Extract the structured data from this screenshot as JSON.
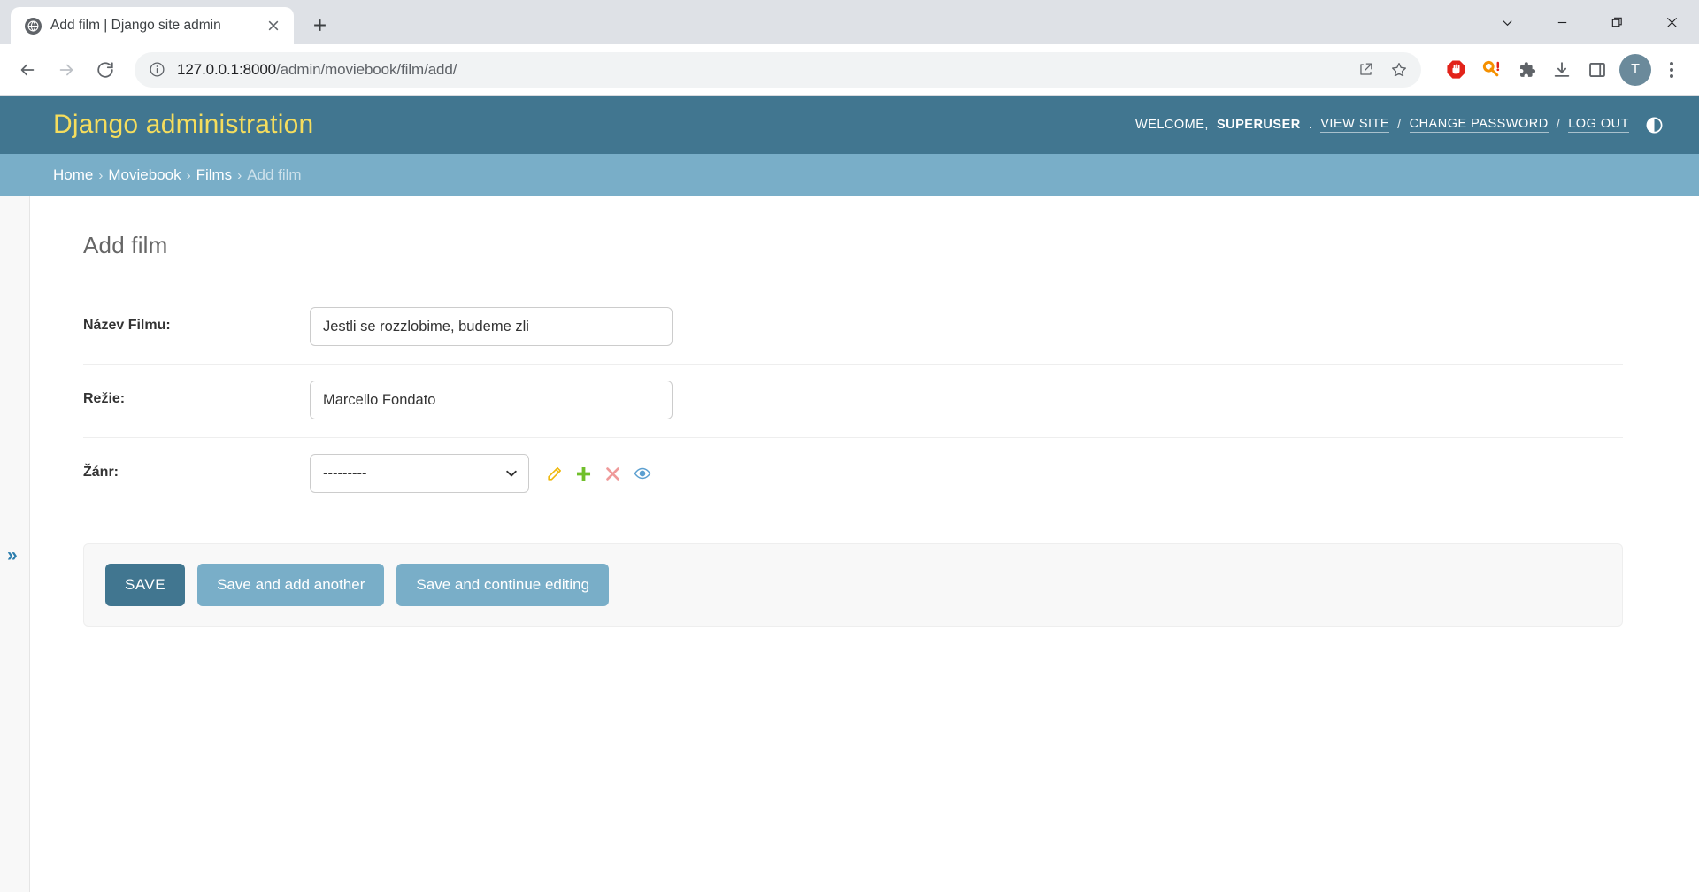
{
  "browser": {
    "tab": {
      "title": "Add film | Django site admin",
      "favicon_name": "globe-icon",
      "close_label": "×"
    },
    "new_tab_label": "+",
    "window_controls": {
      "tab_search": "tab-search-chevron",
      "minimize": "minimize",
      "restore": "restore",
      "close": "close"
    },
    "nav": {
      "back": "back-arrow",
      "forward": "forward-arrow",
      "reload": "reload"
    },
    "omnibox": {
      "url_host": "127.0.0.1:8000",
      "url_path": "/admin/moviebook/film/add/",
      "info_icon": "site-information-icon",
      "share_icon": "share-icon",
      "bookmark_icon": "bookmark-star-icon"
    },
    "extensions": [
      {
        "name": "adblock-icon",
        "color": "#e2231a"
      },
      {
        "name": "password-key-icon",
        "color": "#f59000"
      },
      {
        "name": "extensions-puzzle-icon",
        "color": "#5f6368"
      },
      {
        "name": "downloads-icon",
        "color": "#5f6368"
      },
      {
        "name": "side-panel-icon",
        "color": "#5f6368"
      }
    ],
    "profile": {
      "initial": "T",
      "color": "#6b8a9b"
    },
    "menu_icon": "three-dot-menu-icon"
  },
  "django": {
    "brand": "Django administration",
    "brand_color": "#f5dd5d",
    "header_color": "#417690",
    "breadcrumb_color": "#79aec8",
    "usertools": {
      "welcome_prefix": "Welcome,",
      "username": "SUPERUSER",
      "period": ".",
      "view_site": "View site",
      "sep1": "/",
      "change_password": "Change password",
      "sep2": "/",
      "log_out": "Log out",
      "theme_toggle_icon": "theme-toggle-icon"
    },
    "breadcrumbs": [
      {
        "label": "Home",
        "current": false
      },
      {
        "label": "Moviebook",
        "current": false
      },
      {
        "label": "Films",
        "current": false
      },
      {
        "label": "Add film",
        "current": true
      }
    ],
    "breadcrumb_separator": "›",
    "sidebar_toggle_label": "»",
    "page_title": "Add film",
    "form": {
      "rows": [
        {
          "label": "Název Filmu:",
          "type": "text",
          "value": "Jestli se rozzlobime, budeme zli",
          "placeholder": ""
        },
        {
          "label": "Režie:",
          "type": "text",
          "value": "Marcello Fondato",
          "placeholder": ""
        },
        {
          "label": "Žánr:",
          "type": "select",
          "value": "---------",
          "options": [
            "---------"
          ],
          "related_widgets": [
            {
              "name": "change-related-icon",
              "title": "Change selected",
              "color": "#efb80b"
            },
            {
              "name": "add-related-icon",
              "title": "Add another",
              "color": "#70bf2b"
            },
            {
              "name": "delete-related-icon",
              "title": "Delete selected",
              "color": "#dd4646"
            },
            {
              "name": "view-related-icon",
              "title": "View selected",
              "color": "#2b7dad"
            }
          ]
        }
      ]
    },
    "buttons": {
      "save": "Save",
      "save_and_add_another": "Save and add another",
      "save_and_continue": "Save and continue editing"
    }
  }
}
